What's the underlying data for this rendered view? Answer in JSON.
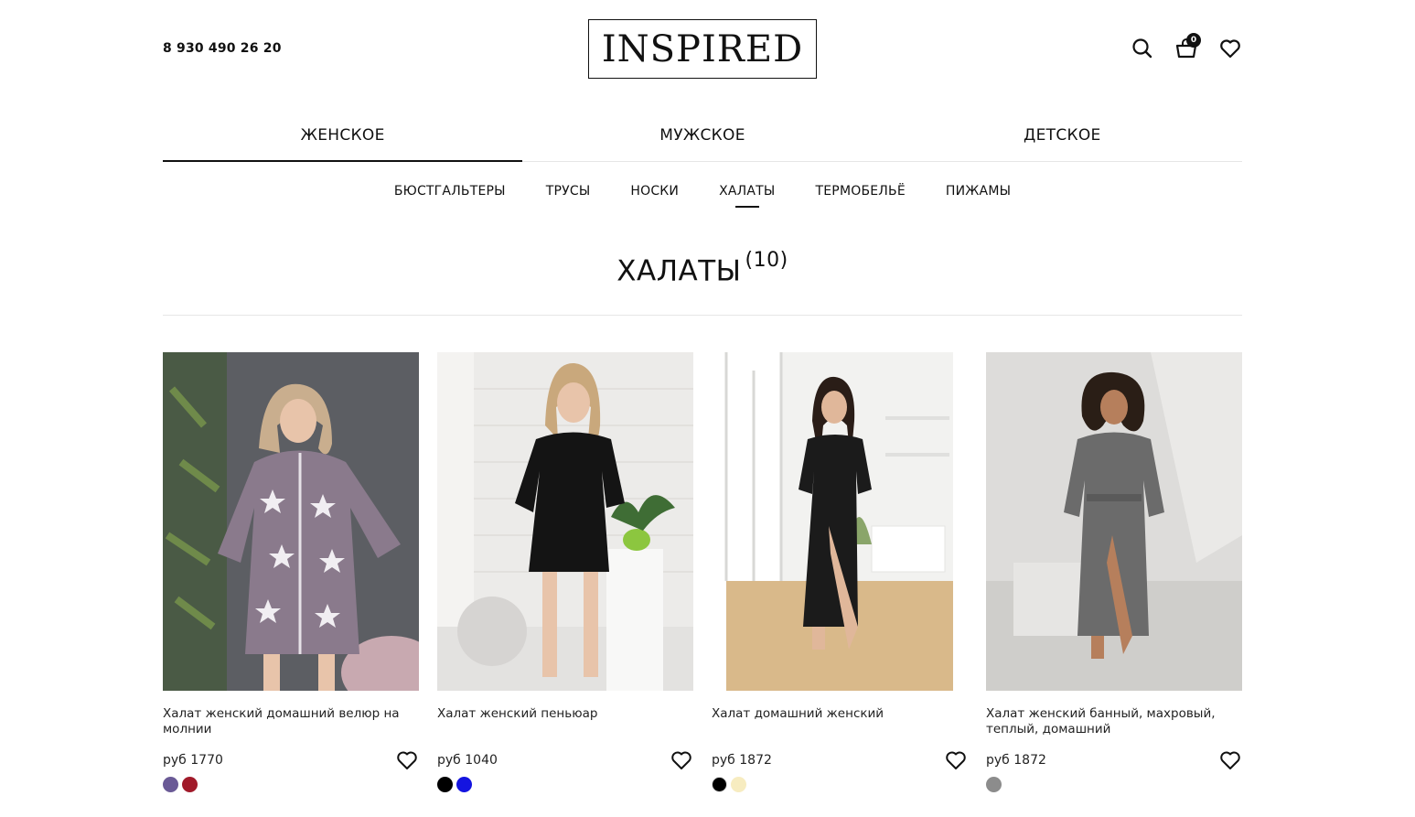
{
  "header": {
    "phone": "8 930 490 26 20",
    "logo": "INSPIRED",
    "cart_count": "0",
    "icons": [
      "search-icon",
      "cart-icon",
      "favorites-icon"
    ]
  },
  "gender_nav": [
    {
      "label": "ЖЕНСКОЕ",
      "active": true
    },
    {
      "label": "МУЖСКОЕ",
      "active": false
    },
    {
      "label": "ДЕТСКОЕ",
      "active": false
    }
  ],
  "category_nav": [
    {
      "label": "БЮСТГАЛЬТЕРЫ",
      "active": false
    },
    {
      "label": "ТРУСЫ",
      "active": false
    },
    {
      "label": "НОСКИ",
      "active": false
    },
    {
      "label": "ХАЛАТЫ",
      "active": true
    },
    {
      "label": "ТЕРМОБЕЛЬЁ",
      "active": false
    },
    {
      "label": "ПИЖАМЫ",
      "active": false
    }
  ],
  "page": {
    "title": "ХАЛАТЫ",
    "count": "(10)"
  },
  "products": [
    {
      "title": "Халат женский домашний велюр на молнии",
      "price": "руб 1770",
      "colors": [
        "#6a5a96",
        "#a11a2a"
      ]
    },
    {
      "title": "Халат женский пеньюар",
      "price": "руб 1040",
      "colors": [
        "#000000",
        "#1414e0"
      ]
    },
    {
      "title": "Халат домашний женский",
      "price": "руб 1872",
      "colors": [
        "#000000",
        "#f7ecc0"
      ]
    },
    {
      "title": "Халат женский банный, махровый, теплый, домашний",
      "price": "руб 1872",
      "colors": [
        "#8c8c8c"
      ]
    }
  ]
}
